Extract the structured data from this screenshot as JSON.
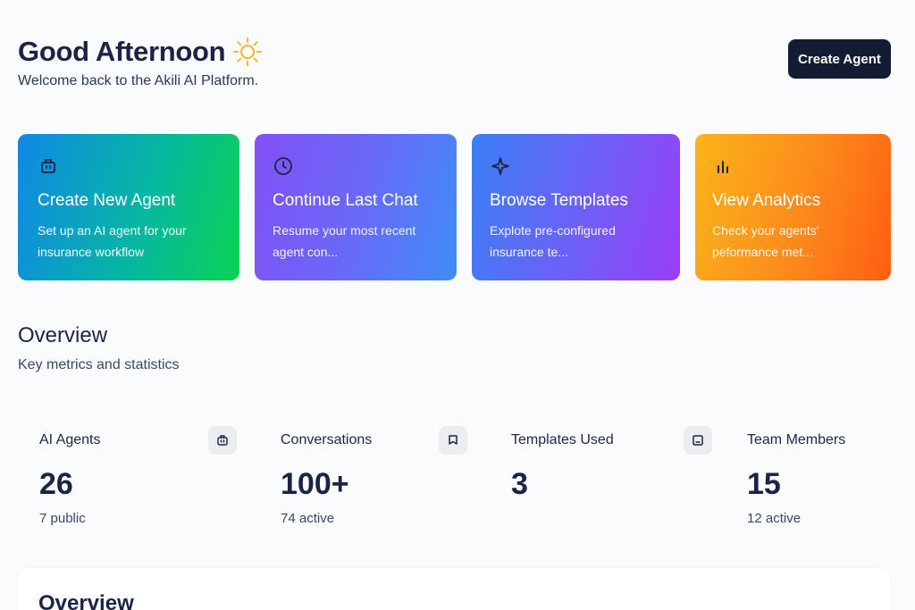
{
  "header": {
    "greeting": "Good Afternoon",
    "subtitle": "Welcome back to the Akili AI Platform.",
    "create_button": "Create Agent",
    "greeting_icon": "sun-icon",
    "sun_color": "#f5b72a"
  },
  "quick_actions": [
    {
      "title": "Create New Agent",
      "description": "Set up an AI agent for your insurance workflow",
      "icon": "robot-icon"
    },
    {
      "title": "Continue Last Chat",
      "description": "Resume your most recent agent con...",
      "icon": "clock-icon"
    },
    {
      "title": "Browse Templates",
      "description": "Explote pre-configured insurance te...",
      "icon": "sparkle-icon"
    },
    {
      "title": "View Analytics",
      "description": "Check your agents' peformance met...",
      "icon": "bar-chart-icon"
    }
  ],
  "overview": {
    "title": "Overview",
    "subtitle": "Key metrics and statistics"
  },
  "stats": [
    {
      "label": "AI Agents",
      "value": "26",
      "sub": "7 public",
      "icon": "robot-icon"
    },
    {
      "label": "Conversations",
      "value": "100+",
      "sub": "74 active",
      "icon": "chat-bubble-icon"
    },
    {
      "label": "Templates Used",
      "value": "3",
      "sub": "",
      "icon": "template-icon"
    },
    {
      "label": "Team Members",
      "value": "15",
      "sub": "12 active",
      "icon": ""
    }
  ],
  "bottom_panel": {
    "title": "Overview"
  },
  "colors": {
    "primary_dark": "#131c33",
    "text_dark": "#1b2445"
  }
}
